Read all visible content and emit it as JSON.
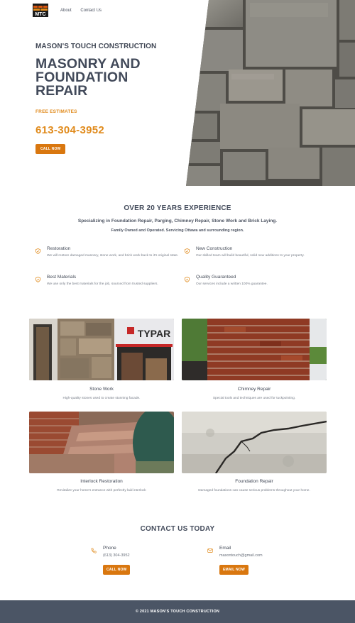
{
  "nav": {
    "logo_icon": "mtc-logo-icon",
    "links": [
      "About",
      "Contact Us"
    ]
  },
  "hero": {
    "company": "MASON'S TOUCH CONSTRUCTION",
    "title_line1": "MASONRY AND",
    "title_line2": "FOUNDATION",
    "title_line3": "REPAIR",
    "free": "FREE ESTIMATES",
    "phone": "613-304-3952",
    "cta": "CALL NOW",
    "image_icon": "stone-wall-photo"
  },
  "experience": {
    "title": "OVER 20 YEARS EXPERIENCE",
    "subtitle": "Specializing in Foundation Repair, Parging, Chimney Repair, Stone Work and Brick Laying.",
    "subtitle2": "Family Owned and Operated. Servicing Ottawa and surrounding region.",
    "features": [
      {
        "title": "Restoration",
        "desc": "We will restore damaged masonry, stone work, and brick work back to it's original state.",
        "icon": "shield-icon"
      },
      {
        "title": "New Construction",
        "desc": "Our skilled team will build beautiful, solid new additions to your property.",
        "icon": "shield-icon"
      },
      {
        "title": "Best Materials",
        "desc": "We use only the best materials for the job, sourced from trusted suppliers.",
        "icon": "shield-icon"
      },
      {
        "title": "Quality Guaranteed",
        "desc": "Our services include a written 100% guarantee.",
        "icon": "shield-icon"
      }
    ]
  },
  "gallery": [
    {
      "title": "Stone Work",
      "desc": "High-quality stones used to create stunning facade."
    },
    {
      "title": "Chimney Repair",
      "desc": "Special tools and techniques are used for tuckpointing."
    },
    {
      "title": "Interlock Restoration",
      "desc": "Revitalize your home's entrance with perfectly laid interlock"
    },
    {
      "title": "Foundation Repair",
      "desc": "Damaged foundations can cause serious problems throughout your home."
    }
  ],
  "gallery_photo_text": "TYPAR",
  "contact": {
    "title": "CONTACT US TODAY",
    "phone_title": "Phone",
    "phone_value": "(613) 304-3952",
    "phone_btn": "CALL NOW",
    "email_title": "Email",
    "email_value": "masontouch@gmail.com",
    "email_btn": "EMAIL NOW"
  },
  "footer": {
    "text": "© 2021 MASON'S TOUCH CONSTRUCTION"
  },
  "colors": {
    "accent": "#d9770f",
    "heading": "#424a5a",
    "footer_bg": "#4b5565"
  }
}
